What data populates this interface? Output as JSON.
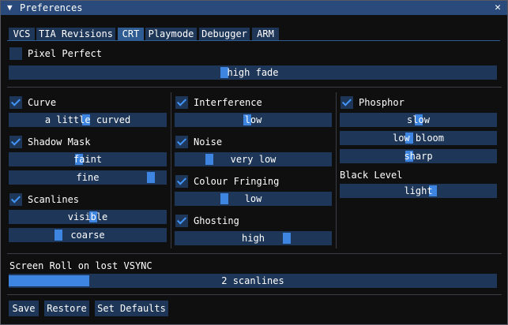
{
  "window": {
    "title": "Preferences",
    "collapse_glyph": "▼",
    "close_glyph": "✕"
  },
  "tabs": [
    {
      "label": "VCS"
    },
    {
      "label": "TIA Revisions"
    },
    {
      "label": "CRT"
    },
    {
      "label": "Playmode"
    },
    {
      "label": "Debugger"
    },
    {
      "label": "ARM"
    }
  ],
  "active_tab": "CRT",
  "pixel_perfect": {
    "label": "Pixel Perfect",
    "checked": false
  },
  "fade": {
    "value": "high fade",
    "level": 0.44
  },
  "col1": {
    "curve": {
      "label": "Curve",
      "checked": true
    },
    "curve_amount": {
      "value": "a little curved",
      "level": 0.49
    },
    "shadow_mask": {
      "label": "Shadow Mask",
      "checked": true
    },
    "mask_intensity": {
      "value": "faint",
      "level": 0.44
    },
    "mask_fineness": {
      "value": "fine",
      "level": 0.93
    },
    "scanlines": {
      "label": "Scanlines",
      "checked": true
    },
    "scanline_intensity": {
      "value": "visible",
      "level": 0.54
    },
    "scanline_coarseness": {
      "value": "coarse",
      "level": 0.3
    }
  },
  "col2": {
    "interference": {
      "label": "Interference",
      "checked": true
    },
    "interference_level": {
      "value": "low",
      "level": 0.46
    },
    "noise": {
      "label": "Noise",
      "checked": true
    },
    "noise_level": {
      "value": "very low",
      "level": 0.2
    },
    "colour_fringing": {
      "label": "Colour Fringing",
      "checked": true
    },
    "fringing_level": {
      "value": "low",
      "level": 0.3
    },
    "ghosting": {
      "label": "Ghosting",
      "checked": true
    },
    "ghosting_level": {
      "value": "high",
      "level": 0.73
    }
  },
  "col3": {
    "phosphor": {
      "label": "Phosphor",
      "checked": true
    },
    "phosphor_speed": {
      "value": "slow",
      "level": 0.5
    },
    "bloom": {
      "value": "low bloom",
      "level": 0.44
    },
    "sharpness": {
      "value": "sharp",
      "level": 0.44
    },
    "black_level_label": "Black Level",
    "black_level": {
      "value": "light",
      "level": 0.6
    }
  },
  "screen_roll": {
    "label": "Screen Roll on lost VSYNC",
    "value": "2 scanlines",
    "level": 0.165
  },
  "buttons": {
    "save": "Save",
    "restore": "Restore",
    "set_defaults": "Set Defaults"
  }
}
